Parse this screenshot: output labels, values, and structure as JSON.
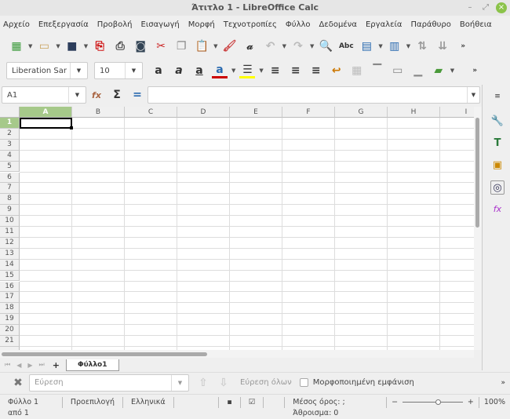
{
  "window": {
    "title": "Άτιτλο 1 - LibreOffice Calc"
  },
  "menu": [
    "Αρχείο",
    "Επεξεργασία",
    "Προβολή",
    "Εισαγωγή",
    "Μορφή",
    "Τεχνοτροπίες",
    "Φύλλο",
    "Δεδομένα",
    "Εργαλεία",
    "Παράθυρο",
    "Βοήθεια"
  ],
  "format": {
    "font_name": "Liberation Sar",
    "font_size": "10"
  },
  "formula": {
    "name_box": "A1",
    "content": ""
  },
  "columns": [
    "A",
    "B",
    "C",
    "D",
    "E",
    "F",
    "G",
    "H",
    "I"
  ],
  "rows": [
    "1",
    "2",
    "3",
    "4",
    "5",
    "6",
    "7",
    "8",
    "9",
    "10",
    "11",
    "12",
    "13",
    "14",
    "15",
    "16",
    "17",
    "18",
    "19",
    "20",
    "21"
  ],
  "selected_cell": "A1",
  "sheets": {
    "tabs": [
      "Φύλλο1"
    ],
    "active": "Φύλλο1"
  },
  "find": {
    "placeholder": "Εύρεση",
    "find_all": "Εύρεση όλων",
    "formatted_display": "Μορφοποιημένη εμφάνιση"
  },
  "status": {
    "sheet": "Φύλλο 1 από 1",
    "style": "Προεπιλογή",
    "language": "Ελληνικά",
    "summary": "Μέσος όρος: ; Άθροισμα: 0",
    "zoom": "100%",
    "zoom_percent": 100
  },
  "colors": {
    "accent": "#a6c98a",
    "font_color": "#cc0000",
    "highlight": "#ffff00"
  }
}
